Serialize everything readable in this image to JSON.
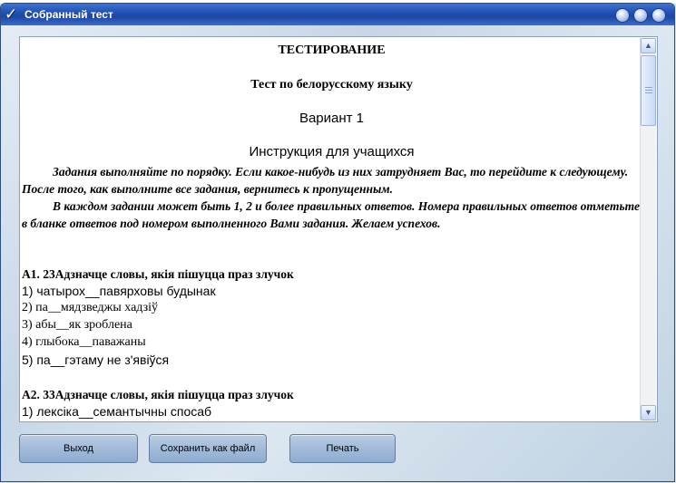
{
  "window": {
    "title": "Собранный тест"
  },
  "document": {
    "heading": "ТЕСТИРОВАНИЕ",
    "subject": "Тест по белорусскому языку",
    "variant": "Вариант 1",
    "instruction_title": "Инструкция для учащихся",
    "instruction_p1": "Задания выполняйте по порядку. Если какое-нибудь из них затрудняет Вас, то перейдите к следующему. После того, как выполните все задания, вернитесь к пропущенным.",
    "instruction_p2": "В каждом задании может быть 1, 2 и более правильных ответов. Номера правильных ответов отметьте в бланке ответов под номером выполненного Вами задания. Желаем успехов.",
    "questions": [
      {
        "title": "А1. 23Адзначце словы, якія пішуцца  праз злучок",
        "options": [
          "1) чатырох__павярховы будынак",
          "2) па__мядзведжы хадзіў",
          "3) абы__як зроблена",
          "4) глыбока__паважаны",
          "5) па__гэтаму не з'явіўся"
        ]
      },
      {
        "title": "А2. 33Адзначце словы, якія пішуцца  праз злучок",
        "options": [
          "1) лексіка__семантычны спосаб"
        ]
      }
    ]
  },
  "buttons": {
    "exit": "Выход",
    "save_as_file": "Сохранить как файл",
    "print": "Печать"
  }
}
